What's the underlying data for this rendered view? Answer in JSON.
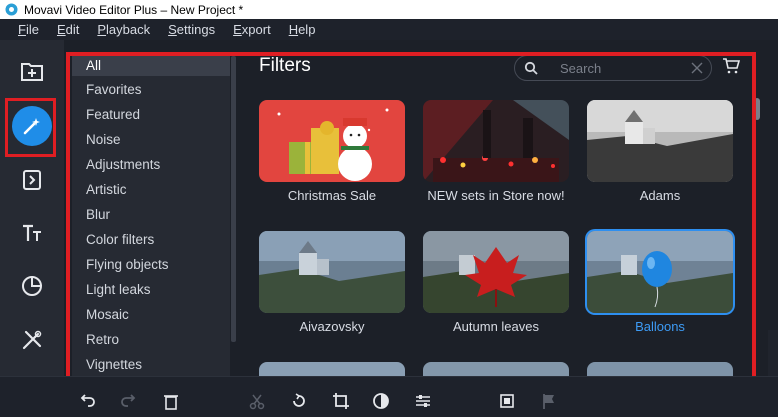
{
  "window": {
    "title": "Movavi Video Editor Plus – New Project *"
  },
  "menu": [
    {
      "label": "File",
      "u": "F",
      "rest": "ile"
    },
    {
      "label": "Edit",
      "u": "E",
      "rest": "dit"
    },
    {
      "label": "Playback",
      "u": "P",
      "rest": "layback"
    },
    {
      "label": "Settings",
      "u": "S",
      "rest": "ettings"
    },
    {
      "label": "Export",
      "u": "E",
      "rest": "xport"
    },
    {
      "label": "Help",
      "u": "H",
      "rest": "elp"
    }
  ],
  "sidebar_tools": [
    {
      "name": "import-files-icon"
    },
    {
      "name": "filters-icon",
      "active": true
    },
    {
      "name": "transitions-icon"
    },
    {
      "name": "titles-icon"
    },
    {
      "name": "stickers-icon"
    },
    {
      "name": "more-tools-icon"
    }
  ],
  "categories": [
    "All",
    "Favorites",
    "Featured",
    "Noise",
    "Adjustments",
    "Artistic",
    "Blur",
    "Color filters",
    "Flying objects",
    "Light leaks",
    "Mosaic",
    "Retro",
    "Vignettes"
  ],
  "selected_category": "All",
  "panel": {
    "title": "Filters",
    "search_placeholder": "Search"
  },
  "filters": [
    {
      "label": "Christmas Sale"
    },
    {
      "label": "NEW sets in Store now!"
    },
    {
      "label": "Adams"
    },
    {
      "label": "Aivazovsky"
    },
    {
      "label": "Autumn leaves"
    },
    {
      "label": "Balloons",
      "selected": true
    }
  ],
  "colors": {
    "accent": "#1f8de8",
    "highlight_box": "#e01e23",
    "selected_text": "#3d9bf5"
  }
}
